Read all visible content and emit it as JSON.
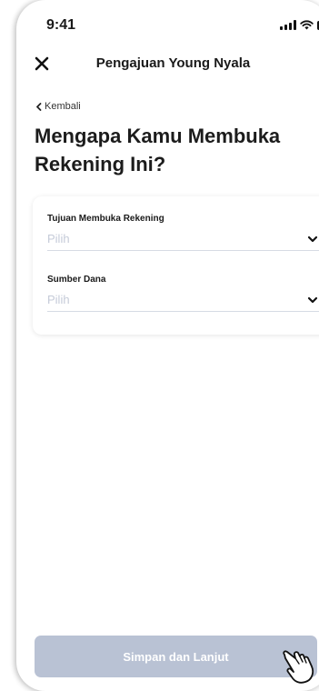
{
  "status_bar": {
    "time": "9:41"
  },
  "header": {
    "title": "Pengajuan Young Nyala"
  },
  "back_link": {
    "label": "Kembali"
  },
  "page": {
    "title": "Mengapa Kamu Membuka Rekening Ini?"
  },
  "form": {
    "fields": [
      {
        "label": "Tujuan Membuka Rekening",
        "placeholder": "Pilih"
      },
      {
        "label": "Sumber Dana",
        "placeholder": "Pilih"
      }
    ]
  },
  "footer": {
    "submit_label": "Simpan dan Lanjut",
    "submit_color": "#b9c2d4"
  },
  "icons": [
    "close-icon",
    "chevron-left-icon",
    "chevron-down-icon",
    "pointing-hand-icon",
    "signal-icon",
    "wifi-icon",
    "battery-icon"
  ]
}
